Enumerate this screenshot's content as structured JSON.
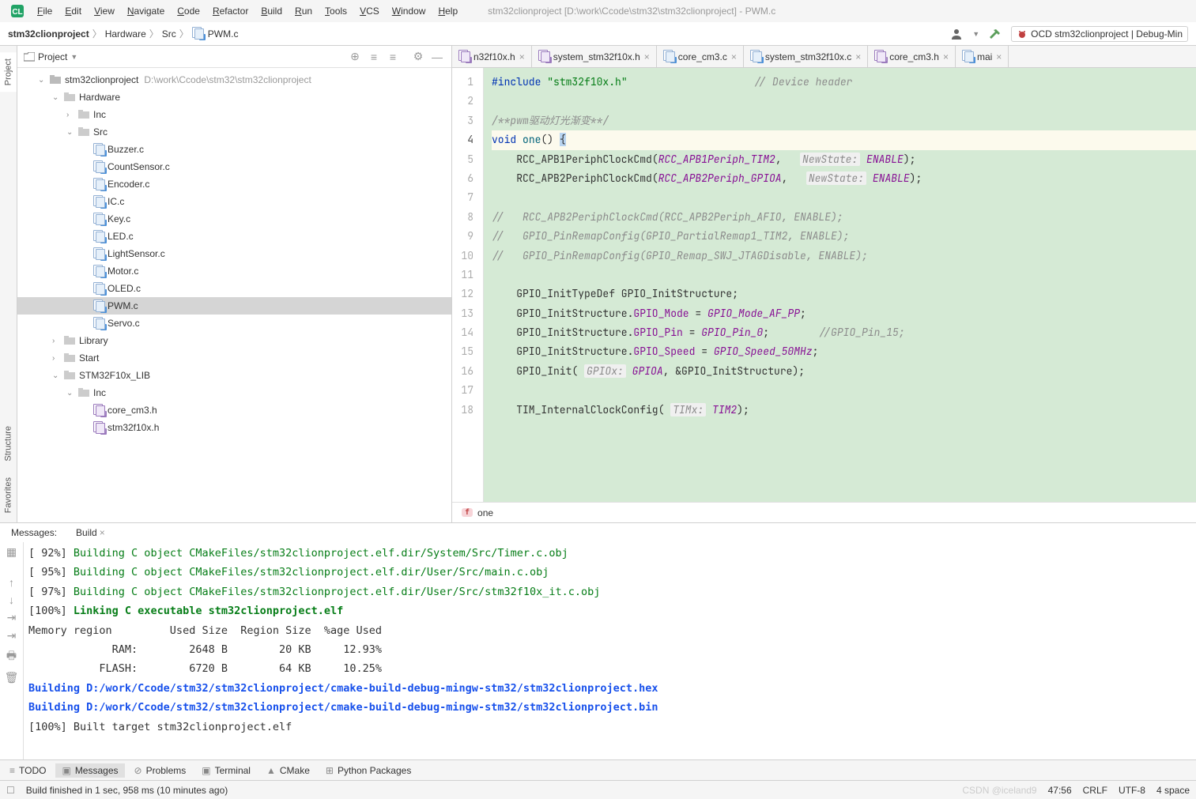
{
  "window_title": "stm32clionproject [D:\\work\\Ccode\\stm32\\stm32clionproject] - PWM.c",
  "main_menu": [
    "File",
    "Edit",
    "View",
    "Navigate",
    "Code",
    "Refactor",
    "Build",
    "Run",
    "Tools",
    "VCS",
    "Window",
    "Help"
  ],
  "breadcrumbs": {
    "root": "stm32clionproject",
    "items": [
      "Hardware",
      "Src"
    ],
    "file": "PWM.c"
  },
  "run_config": "OCD stm32clionproject | Debug-Min",
  "project_panel": {
    "title": "Project",
    "root": {
      "name": "stm32clionproject",
      "path": "D:\\work\\Ccode\\stm32\\stm32clionproject"
    },
    "tree": [
      {
        "level": 1,
        "name": "stm32clionproject",
        "path": "D:\\work\\Ccode\\stm32\\stm32clionproject",
        "type": "root",
        "open": true
      },
      {
        "level": 2,
        "name": "Hardware",
        "type": "folder",
        "open": true
      },
      {
        "level": 3,
        "name": "Inc",
        "type": "folder",
        "open": false,
        "hasChev": true
      },
      {
        "level": 3,
        "name": "Src",
        "type": "folder",
        "open": true
      },
      {
        "level": 4,
        "name": "Buzzer.c",
        "type": "cfile"
      },
      {
        "level": 4,
        "name": "CountSensor.c",
        "type": "cfile"
      },
      {
        "level": 4,
        "name": "Encoder.c",
        "type": "cfile"
      },
      {
        "level": 4,
        "name": "IC.c",
        "type": "cfile"
      },
      {
        "level": 4,
        "name": "Key.c",
        "type": "cfile"
      },
      {
        "level": 4,
        "name": "LED.c",
        "type": "cfile"
      },
      {
        "level": 4,
        "name": "LightSensor.c",
        "type": "cfile"
      },
      {
        "level": 4,
        "name": "Motor.c",
        "type": "cfile"
      },
      {
        "level": 4,
        "name": "OLED.c",
        "type": "cfile"
      },
      {
        "level": 4,
        "name": "PWM.c",
        "type": "cfile",
        "selected": true
      },
      {
        "level": 4,
        "name": "Servo.c",
        "type": "cfile"
      },
      {
        "level": 2,
        "name": "Library",
        "type": "folder",
        "open": false,
        "hasChev": true
      },
      {
        "level": 2,
        "name": "Start",
        "type": "folder",
        "open": false,
        "hasChev": true
      },
      {
        "level": 2,
        "name": "STM32F10x_LIB",
        "type": "folder",
        "open": true
      },
      {
        "level": 3,
        "name": "Inc",
        "type": "folder",
        "open": true
      },
      {
        "level": 4,
        "name": "core_cm3.h",
        "type": "hfile"
      },
      {
        "level": 4,
        "name": "stm32f10x.h",
        "type": "hfile"
      }
    ]
  },
  "editor_tabs": [
    {
      "name": "n32f10x.h",
      "type": "h"
    },
    {
      "name": "system_stm32f10x.h",
      "type": "h"
    },
    {
      "name": "core_cm3.c",
      "type": "c"
    },
    {
      "name": "system_stm32f10x.c",
      "type": "c"
    },
    {
      "name": "core_cm3.h",
      "type": "h"
    },
    {
      "name": "mai",
      "type": "c"
    }
  ],
  "editor": {
    "lines_count": 18,
    "active_line": 4,
    "crumb_fn": "one",
    "code": {
      "l1_a": "#include",
      "l1_b": "\"stm32f10x.h\"",
      "l1_c": "// Device header",
      "l3": "/**pwm驱动灯光渐变**/",
      "l4_a": "void",
      "l4_b": "one",
      "l4_c": "() ",
      "l4_d": "{",
      "l5_a": "    RCC_APB1PeriphClockCmd(",
      "l5_b": "RCC_APB1Periph_TIM2",
      "l5_c": ",   ",
      "l5_p": "NewState:",
      "l5_v": "ENABLE",
      "l5_d": ");",
      "l6_a": "    RCC_APB2PeriphClockCmd(",
      "l6_b": "RCC_APB2Periph_GPIOA",
      "l6_c": ",   ",
      "l6_p": "NewState:",
      "l6_v": "ENABLE",
      "l6_d": ");",
      "l8": "//   RCC_APB2PeriphClockCmd(RCC_APB2Periph_AFIO, ENABLE);",
      "l9": "//   GPIO_PinRemapConfig(GPIO_PartialRemap1_TIM2, ENABLE);",
      "l10": "//   GPIO_PinRemapConfig(GPIO_Remap_SWJ_JTAGDisable, ENABLE);",
      "l12_a": "    GPIO_InitTypeDef GPIO_InitStructure;",
      "l13_a": "    GPIO_InitStructure.",
      "l13_b": "GPIO_Mode",
      "l13_c": " = ",
      "l13_d": "GPIO_Mode_AF_PP",
      "l13_e": ";",
      "l14_a": "    GPIO_InitStructure.",
      "l14_b": "GPIO_Pin",
      "l14_c": " = ",
      "l14_d": "GPIO_Pin_0",
      "l14_e": ";",
      "l14_com": "        //GPIO_Pin_15;",
      "l15_a": "    GPIO_InitStructure.",
      "l15_b": "GPIO_Speed",
      "l15_c": " = ",
      "l15_d": "GPIO_Speed_50MHz",
      "l15_e": ";",
      "l16_a": "    GPIO_Init( ",
      "l16_p": "GPIOx:",
      "l16_b": "GPIOA",
      "l16_c": ", &GPIO_InitStructure);",
      "l18_a": "    TIM_InternalClockConfig( ",
      "l18_p": "TIMx:",
      "l18_b": "TIM2",
      "l18_c": ");"
    }
  },
  "messages_panel": {
    "tab_messages": "Messages:",
    "tab_build": "Build",
    "output": {
      "r1a": "[ 92%] ",
      "r1b": "Building C object CMakeFiles/stm32clionproject.elf.dir/System/Src/Timer.c.obj",
      "r2a": "[ 95%] ",
      "r2b": "Building C object CMakeFiles/stm32clionproject.elf.dir/User/Src/main.c.obj",
      "r3a": "[ 97%] ",
      "r3b": "Building C object CMakeFiles/stm32clionproject.elf.dir/User/Src/stm32f10x_it.c.obj",
      "r4a": "[100%] ",
      "r4b": "Linking C executable stm32clionproject.elf",
      "r5": "Memory region         Used Size  Region Size  %age Used",
      "r6": "             RAM:        2648 B        20 KB     12.93%",
      "r7": "           FLASH:        6720 B        64 KB     10.25%",
      "r8": "Building D:/work/Ccode/stm32/stm32clionproject/cmake-build-debug-mingw-stm32/stm32clionproject.hex",
      "r9": "Building D:/work/Ccode/stm32/stm32clionproject/cmake-build-debug-mingw-stm32/stm32clionproject.bin",
      "r10": "[100%] Built target stm32clionproject.elf"
    }
  },
  "bottom_tabs": {
    "todo": "TODO",
    "messages": "Messages",
    "problems": "Problems",
    "terminal": "Terminal",
    "cmake": "CMake",
    "python": "Python Packages"
  },
  "status_bar": {
    "build_msg": "Build finished in 1 sec, 958 ms (10 minutes ago)",
    "watermark": "CSDN @iceland9",
    "cursor": "47:56",
    "le": "CRLF",
    "encoding": "UTF-8",
    "indent": "4 space"
  },
  "left_rail": {
    "project": "Project",
    "structure": "Structure",
    "favorites": "Favorites"
  }
}
